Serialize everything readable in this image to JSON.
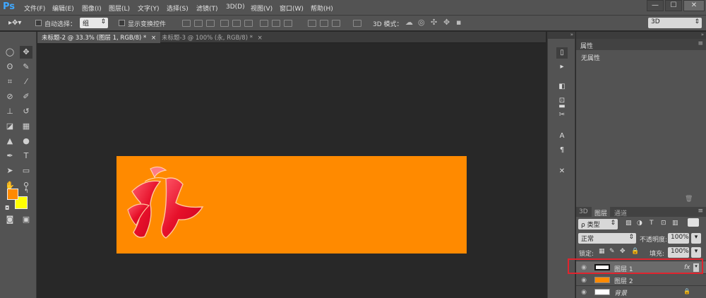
{
  "app": {
    "logo": "Ps"
  },
  "menubar": {
    "items": [
      "文件(F)",
      "编辑(E)",
      "图像(I)",
      "图层(L)",
      "文字(Y)",
      "选择(S)",
      "滤镜(T)",
      "3D(D)",
      "视图(V)",
      "窗口(W)",
      "帮助(H)"
    ],
    "window_buttons": [
      "—",
      "☐",
      "✕"
    ]
  },
  "options": {
    "auto_select_label": "自动选择：",
    "auto_select_value": "组",
    "show_transform_label": "显示变换控件",
    "mode_3d_label": "3D 模式：",
    "workspace_value": "3D"
  },
  "tabs": [
    {
      "label": "未标题-2 @ 33.3% (图层 1, RGB/8) *",
      "close": "×"
    },
    {
      "label": "未标题-3 @ 100% (永, RGB/8) *",
      "close": "×"
    }
  ],
  "colors": {
    "foreground": "#ff8a00",
    "background": "#ffff00",
    "canvas": "#ff8a00"
  },
  "canvas": {
    "glyph": "永"
  },
  "properties_panel": {
    "title": "属性",
    "content": "无属性"
  },
  "layers_panel": {
    "tabs": [
      "3D",
      "图层",
      "通道"
    ],
    "filter_label": "ρ 类型",
    "blend_mode": "正常",
    "opacity_label": "不透明度:",
    "opacity_value": "100%",
    "lock_label": "锁定:",
    "fill_label": "填充:",
    "fill_value": "100%",
    "layers": [
      {
        "name": "图层 1",
        "fx": "fx"
      },
      {
        "name": "图层 2",
        "fx": ""
      },
      {
        "name": "背景",
        "fx": ""
      }
    ]
  }
}
